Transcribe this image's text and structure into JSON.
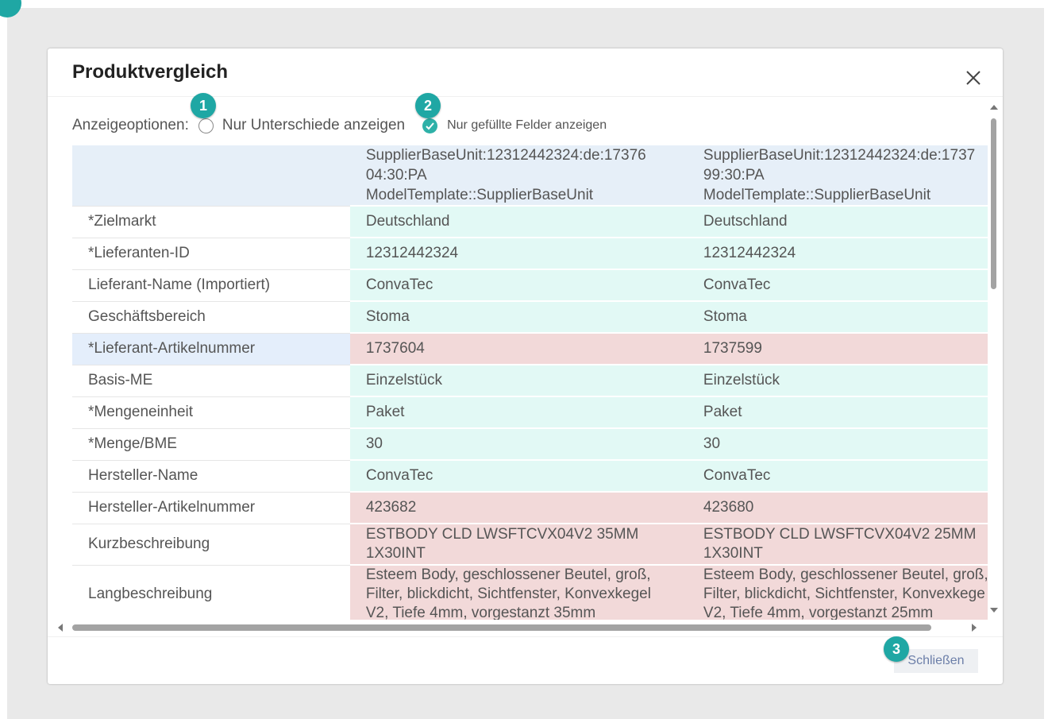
{
  "dialog": {
    "title": "Produktvergleich"
  },
  "options": {
    "label": "Anzeigeoptionen:",
    "only_differences": {
      "label": "Nur Unterschiede anzeigen",
      "checked": false
    },
    "only_filled": {
      "label": "Nur gefüllte Felder anzeigen",
      "checked": true
    }
  },
  "callouts": [
    "1",
    "2",
    "3"
  ],
  "table": {
    "columns": [
      {
        "line1": "SupplierBaseUnit:12312442324:de:17376",
        "line2": "04:30:PA",
        "line3": "ModelTemplate::SupplierBaseUnit"
      },
      {
        "line1": "SupplierBaseUnit:12312442324:de:1737",
        "line2": "99:30:PA",
        "line3": "ModelTemplate::SupplierBaseUnit"
      }
    ],
    "rows": [
      {
        "label": "*Zielmarkt",
        "a": "Deutschland",
        "b": "Deutschland",
        "status": "same"
      },
      {
        "label": "*Lieferanten-ID",
        "a": "12312442324",
        "b": "12312442324",
        "status": "same"
      },
      {
        "label": "Lieferant-Name (Importiert)",
        "a": "ConvaTec",
        "b": "ConvaTec",
        "status": "same"
      },
      {
        "label": "Geschäftsbereich",
        "a": "Stoma",
        "b": "Stoma",
        "status": "same"
      },
      {
        "label": "*Lieferant-Artikelnummer",
        "a": "1737604",
        "b": "1737599",
        "status": "diff"
      },
      {
        "label": "Basis-ME",
        "a": "Einzelstück",
        "b": "Einzelstück",
        "status": "same"
      },
      {
        "label": "*Mengeneinheit",
        "a": "Paket",
        "b": "Paket",
        "status": "same"
      },
      {
        "label": "*Menge/BME",
        "a": "30",
        "b": "30",
        "status": "same"
      },
      {
        "label": "Hersteller-Name",
        "a": "ConvaTec",
        "b": "ConvaTec",
        "status": "same"
      },
      {
        "label": "Hersteller-Artikelnummer",
        "a": "423682",
        "b": "423680",
        "status": "diff"
      }
    ],
    "kurz": {
      "label": "Kurzbeschreibung",
      "a1": "ESTBODY CLD LWSFTCVX04V2 35MM",
      "a2": "1X30INT",
      "b1": "ESTBODY CLD LWSFTCVX04V2 25MM",
      "b2": "1X30INT"
    },
    "lang": {
      "label": "Langbeschreibung",
      "a1": "Esteem Body, geschlossener Beutel, groß,",
      "a2": "Filter, blickdicht, Sichtfenster, Konvexkegel",
      "a3": "V2, Tiefe 4mm, vorgestanzt 35mm",
      "b1": "Esteem Body, geschlossener Beutel, groß,",
      "b2": "Filter, blickdicht, Sichtfenster, Konvexkege",
      "b3": "V2, Tiefe 4mm, vorgestanzt 25mm"
    }
  },
  "footer": {
    "close_label": "Schließen"
  },
  "colors": {
    "accent": "#1fa7a4",
    "same_row": "#e2f9f5",
    "diff_row": "#f2d9d9",
    "header_row": "#e6eff8"
  }
}
